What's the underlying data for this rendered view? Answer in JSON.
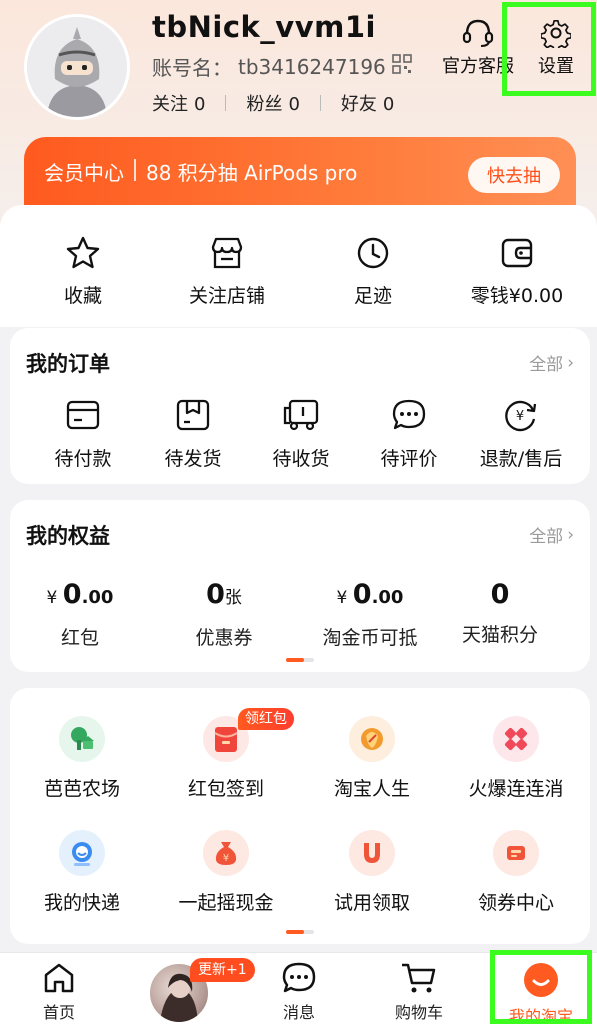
{
  "colors": {
    "accent": "#ff5a1f",
    "highlight": "#3cfc1f"
  },
  "profile": {
    "username": "tbNick_vvm1i",
    "account_label": "账号名：",
    "account_id": "tb3416247196",
    "following_label": "关注",
    "following_count": "0",
    "fans_label": "粉丝",
    "fans_count": "0",
    "friends_label": "好友",
    "friends_count": "0"
  },
  "header_buttons": {
    "service_label": "官方客服",
    "settings_label": "设置"
  },
  "member_banner": {
    "title": "会员中心",
    "promo": "88 积分抽 AirPods pro",
    "button_label": "快去抽"
  },
  "quick_actions": [
    {
      "label": "收藏",
      "icon": "star-icon"
    },
    {
      "label": "关注店铺",
      "icon": "store-icon"
    },
    {
      "label": "足迹",
      "icon": "clock-icon"
    },
    {
      "label": "零钱¥0.00",
      "icon": "wallet-icon"
    }
  ],
  "orders": {
    "title": "我的订单",
    "more_label": "全部",
    "items": [
      {
        "label": "待付款",
        "icon": "card-icon"
      },
      {
        "label": "待发货",
        "icon": "package-icon"
      },
      {
        "label": "待收货",
        "icon": "truck-icon"
      },
      {
        "label": "待评价",
        "icon": "chat-dots-icon"
      },
      {
        "label": "退款/售后",
        "icon": "refund-icon"
      }
    ]
  },
  "benefits": {
    "title": "我的权益",
    "more_label": "全部",
    "items": [
      {
        "prefix": "¥ ",
        "int": "0",
        "dec": ".00",
        "unit": "",
        "label": "红包"
      },
      {
        "prefix": "",
        "int": "0",
        "dec": "",
        "unit": "张",
        "label": "优惠券"
      },
      {
        "prefix": "¥ ",
        "int": "0",
        "dec": ".00",
        "unit": "",
        "label": "淘金币可抵"
      },
      {
        "prefix": "",
        "int": "0",
        "dec": "",
        "unit": "",
        "label": "天猫积分"
      }
    ]
  },
  "apps": {
    "badge": "领红包",
    "items": [
      {
        "label": "芭芭农场",
        "icon": "farm-icon",
        "color": "#3fb36b"
      },
      {
        "label": "红包签到",
        "icon": "red-envelope-icon",
        "color": "#f0453a"
      },
      {
        "label": "淘宝人生",
        "icon": "life-icon",
        "color": "#f29a2e"
      },
      {
        "label": "火爆连连消",
        "icon": "puzzle-icon",
        "color": "#f04a5a"
      },
      {
        "label": "我的快递",
        "icon": "courier-icon",
        "color": "#3a8cf0"
      },
      {
        "label": "一起摇现金",
        "icon": "money-bag-icon",
        "color": "#f0553a"
      },
      {
        "label": "试用领取",
        "icon": "magnet-icon",
        "color": "#f0553a"
      },
      {
        "label": "领券中心",
        "icon": "coupon-icon",
        "color": "#f0553a"
      }
    ]
  },
  "tabbar": {
    "home": "首页",
    "update_badge": "更新+1",
    "messages": "消息",
    "cart": "购物车",
    "mine": "我的淘宝"
  }
}
